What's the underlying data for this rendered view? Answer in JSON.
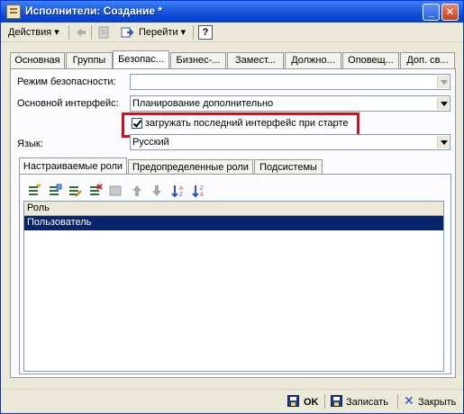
{
  "window": {
    "title": "Исполнители: Создание *"
  },
  "toolbar": {
    "actions_label": "Действия",
    "goto_label": "Перейти",
    "help_label": "?"
  },
  "tabs": [
    {
      "label": "Основная"
    },
    {
      "label": "Группы"
    },
    {
      "label": "Безопас..."
    },
    {
      "label": "Бизнес-..."
    },
    {
      "label": "Замест..."
    },
    {
      "label": "Должно..."
    },
    {
      "label": "Оповещ..."
    },
    {
      "label": "Доп. св..."
    }
  ],
  "form": {
    "security_mode_label": "Режим безопасности:",
    "security_mode_value": "",
    "main_interface_label": "Основной интерфейс:",
    "main_interface_value": "Планирование дополнительно",
    "load_interface_checkbox_label": "загружать последний интерфейс при старте",
    "load_interface_checked": true,
    "language_label": "Язык:",
    "language_value": "Русский"
  },
  "subtabs": [
    {
      "label": "Настраиваемые роли"
    },
    {
      "label": "Предопределенные роли"
    },
    {
      "label": "Подсистемы"
    }
  ],
  "roles_table": {
    "columns": [
      "Роль"
    ],
    "rows": [
      {
        "role": "Пользователь",
        "selected": true
      }
    ]
  },
  "bottom": {
    "ok_label": "OK",
    "save_label": "Записать",
    "close_label": "Закрыть"
  },
  "colors": {
    "title_bar": "#0a49d6",
    "highlight": "#d2121b",
    "selection": "#0a246a"
  }
}
